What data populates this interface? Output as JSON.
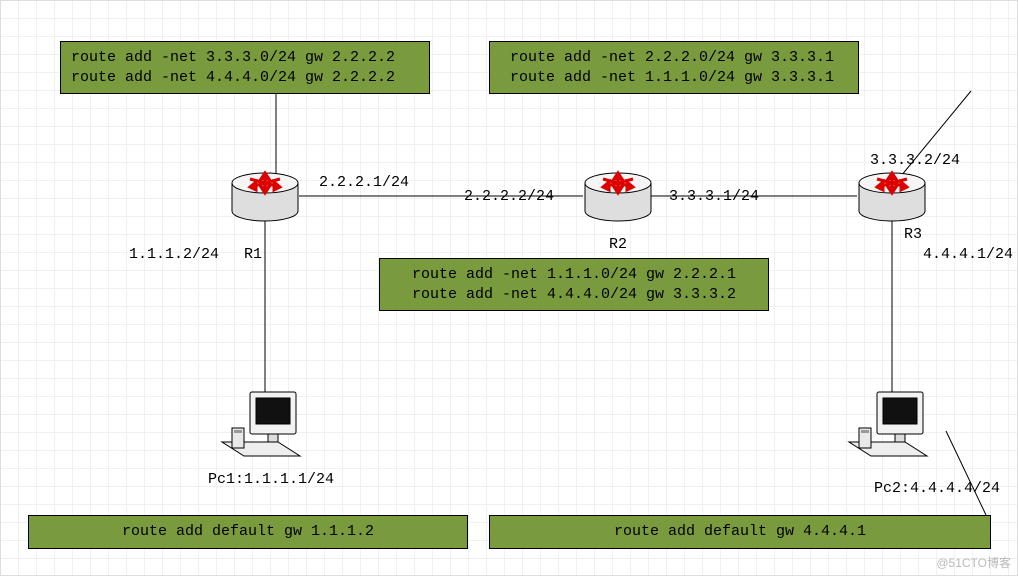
{
  "boxes": {
    "r1": {
      "line0": "route add -net 3.3.3.0/24 gw 2.2.2.2",
      "line1": "route add -net 4.4.4.0/24 gw 2.2.2.2"
    },
    "r3": {
      "line0": "route add -net 2.2.2.0/24 gw 3.3.3.1",
      "line1": "route add -net 1.1.1.0/24 gw 3.3.3.1"
    },
    "r2": {
      "line0": "route add -net 1.1.1.0/24 gw 2.2.2.1",
      "line1": "route add -net 4.4.4.0/24 gw 3.3.3.2"
    },
    "pc1": {
      "line0": "route add default gw 1.1.1.2"
    },
    "pc2": {
      "line0": "route add default gw 4.4.4.1"
    }
  },
  "if_labels": {
    "r1_right": "2.2.2.1/24",
    "r1_down": "1.1.1.2/24",
    "r2_left": "2.2.2.2/24",
    "r2_right": "3.3.3.1/24",
    "r3_top": "3.3.3.2/24",
    "r3_down": "4.4.4.1/24"
  },
  "device_labels": {
    "r1": "R1",
    "r2": "R2",
    "r3": "R3",
    "pc1": "Pc1:1.1.1.1/24",
    "pc2": "Pc2:4.4.4.4/24"
  },
  "watermark": "@51CTO博客"
}
